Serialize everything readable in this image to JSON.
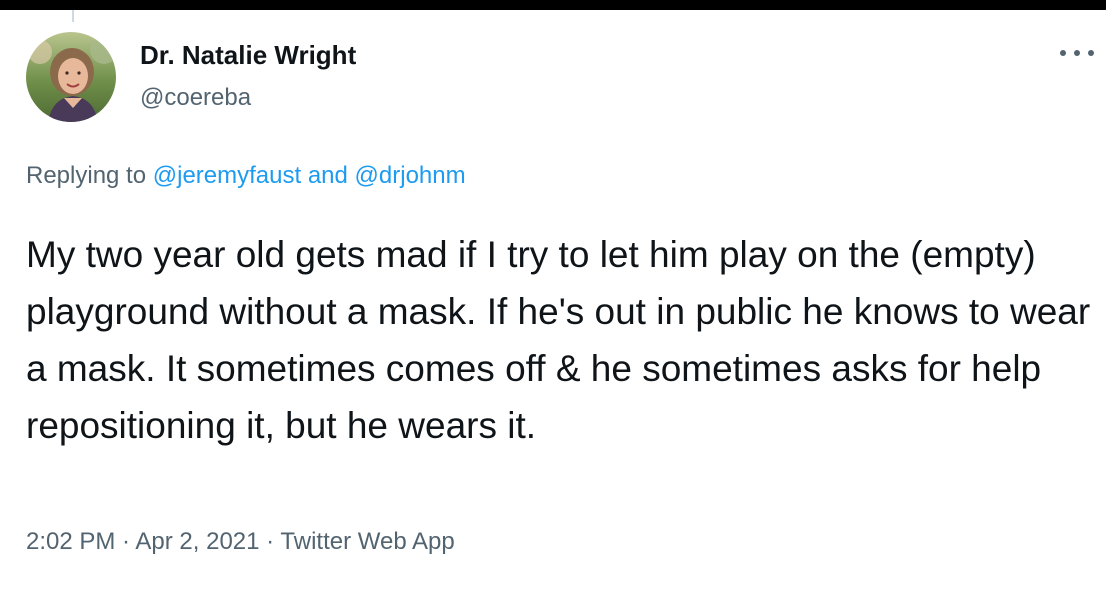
{
  "tweet": {
    "author": {
      "display_name": "Dr. Natalie Wright",
      "handle": "@coereba",
      "avatar_icon": "profile-photo"
    },
    "reply_context": {
      "prefix": "Replying to ",
      "mentions": [
        "@jeremyfaust",
        "@drjohnm"
      ],
      "conjunction": " and "
    },
    "text": "My two year old gets mad if I try to let him play on the (empty) playground without a mask. If he's out in public he knows to wear a mask. It sometimes comes off & he sometimes asks for help repositioning it, but he wears it.",
    "meta": {
      "time": "2:02 PM",
      "separator": " · ",
      "date": "Apr 2, 2021",
      "source": "Twitter Web App"
    },
    "more_icon": "ellipsis-icon"
  },
  "colors": {
    "text_primary": "#0f1419",
    "text_secondary": "#536471",
    "link": "#1d9bf0",
    "divider": "#cfd9de",
    "background": "#ffffff",
    "frame": "#000000"
  }
}
